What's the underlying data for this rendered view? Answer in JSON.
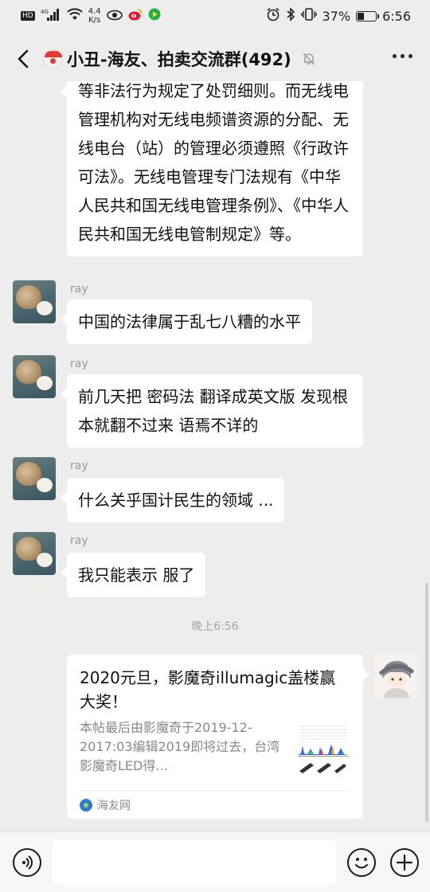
{
  "status_bar": {
    "hd": "HD",
    "net_type": "4G",
    "net_speed": "4.4",
    "net_speed_unit": "K/s",
    "battery_percent": "37%",
    "battery_level": 0.37,
    "time": "6:56"
  },
  "header": {
    "title": "小丑-海友、拍卖交流群(492)"
  },
  "messages": [
    {
      "sender": "",
      "text": "等非法行为规定了处罚细则。而无线电管理机构对无线电频谱资源的分配、无线电台（站）的管理必须遵照《行政许可法》。无线电管理专门法规有《中华人民共和国无线电管理条例》、《中华人民共和国无线电管制规定》等。"
    },
    {
      "sender": "ray",
      "text": "中国的法律属于乱七八糟的水平"
    },
    {
      "sender": "ray",
      "text": "前几天把 密码法 翻译成英文版 发现根本就翻不过来 语焉不详的"
    },
    {
      "sender": "ray",
      "text": "什么关乎国计民生的领域 ..."
    },
    {
      "sender": "ray",
      "text": "我只能表示 服了"
    }
  ],
  "timestamp": "晚上6:56",
  "link_card": {
    "title": "2020元旦，影魔奇illumagic盖楼赢大奖！",
    "description": "本帖最后由影魔奇于2019-12-2017:03编辑2019即将过去，台湾影魔奇LED得...",
    "source": "海友网"
  },
  "input_bar": {
    "placeholder": ""
  }
}
